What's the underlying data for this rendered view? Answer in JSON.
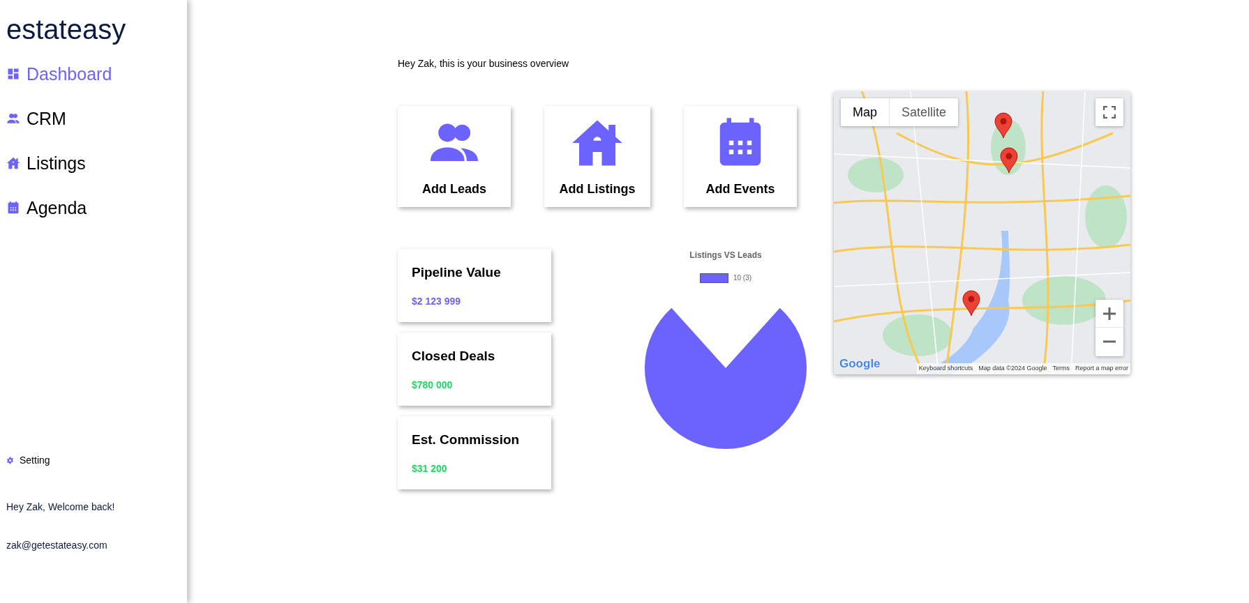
{
  "sidebar": {
    "logo": "estateasy",
    "nav": [
      {
        "label": "Dashboard",
        "selected": true
      },
      {
        "label": "CRM",
        "selected": false
      },
      {
        "label": "Listings",
        "selected": false
      },
      {
        "label": "Agenda",
        "selected": false
      }
    ],
    "setting": "Setting",
    "welcome": "Hey Zak, Welcome back!",
    "email": "zak@getestateasy.com"
  },
  "greeting": "Hey Zak, this is your business overview",
  "actions": [
    {
      "label": "Add Leads"
    },
    {
      "label": "Add Listings"
    },
    {
      "label": "Add Events"
    }
  ],
  "stats": [
    {
      "title": "Pipeline Value",
      "value": "$2 123 999",
      "color": "#6c63ff"
    },
    {
      "title": "Closed Deals",
      "value": "$780 000",
      "color": "#1ed760"
    },
    {
      "title": "Est. Commission",
      "value": "$31 200",
      "color": "#1ed760"
    }
  ],
  "chart": {
    "title": "Listings VS Leads",
    "legend": "10 (3)",
    "color": "#6c63ff"
  },
  "map": {
    "types": [
      {
        "label": "Map",
        "selected": true
      },
      {
        "label": "Satellite",
        "selected": false
      }
    ],
    "logo": "Google",
    "attribution": [
      "Keyboard shortcuts",
      "Map data ©2024 Google",
      "Terms",
      "Report a map error"
    ]
  }
}
